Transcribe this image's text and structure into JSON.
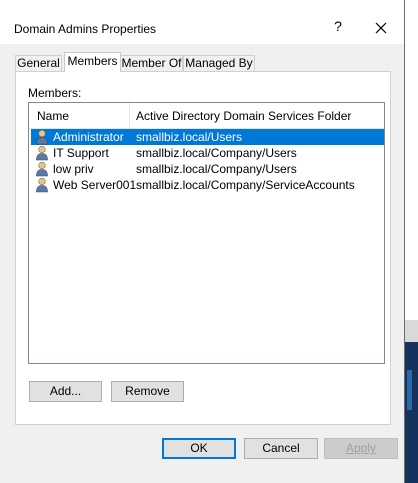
{
  "window": {
    "title": "Domain Admins Properties",
    "help_glyph": "?"
  },
  "tabs": [
    {
      "label": "General",
      "active": false
    },
    {
      "label": "Members",
      "active": true
    },
    {
      "label": "Member Of",
      "active": false
    },
    {
      "label": "Managed By",
      "active": false
    }
  ],
  "members": {
    "label": "Members:",
    "columns": [
      "Name",
      "Active Directory Domain Services Folder"
    ],
    "rows": [
      {
        "name": "Administrator",
        "folder": "smallbiz.local/Users",
        "selected": true
      },
      {
        "name": "IT Support",
        "folder": "smallbiz.local/Company/Users",
        "selected": false
      },
      {
        "name": "low priv",
        "folder": "smallbiz.local/Company/Users",
        "selected": false
      },
      {
        "name": "Web Server001",
        "folder": "smallbiz.local/Company/ServiceAccounts",
        "selected": false
      }
    ]
  },
  "buttons": {
    "add": "Add...",
    "remove": "Remove",
    "ok": "OK",
    "cancel": "Cancel",
    "apply": "Apply"
  },
  "colors": {
    "selection": "#0078d7",
    "user_icon": "#5a7aa3"
  },
  "icons": {
    "row_icon": "user-icon",
    "close": "close-icon"
  }
}
